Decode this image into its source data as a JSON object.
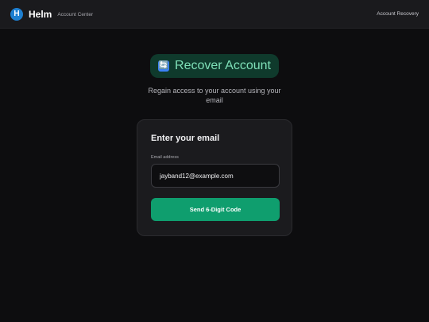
{
  "header": {
    "logo_letter": "H",
    "brand_name": "Helm",
    "brand_subtitle": "Account Center",
    "nav_link": "Account Recovery"
  },
  "hero": {
    "icon": "refresh-icon",
    "icon_glyph": "🔄",
    "title": "Recover Account",
    "subtitle": "Regain access to your account using your email"
  },
  "form": {
    "title": "Enter your email",
    "email_label": "Email address",
    "email_value": "jayband12@example.com",
    "submit_label": "Send 6-Digit Code"
  },
  "colors": {
    "background": "#0d0d0f",
    "accent": "#0f9e6e",
    "title_green": "#7fe0b8",
    "logo_blue": "#1e7fd0"
  }
}
